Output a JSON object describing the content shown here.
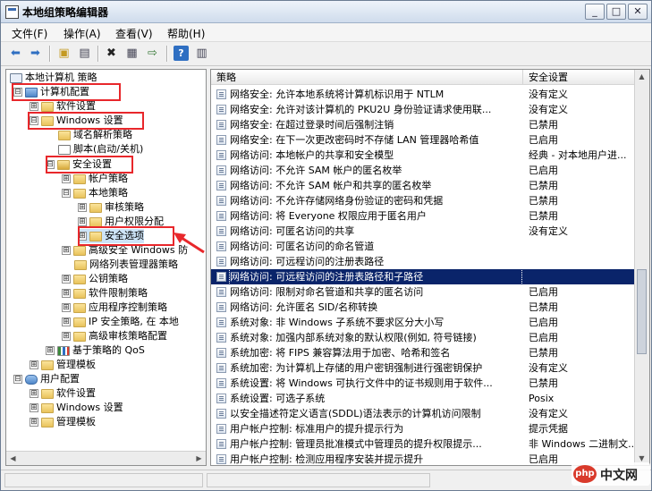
{
  "window": {
    "title": "本地组策略编辑器",
    "controls": [
      "_",
      "□",
      "✕"
    ]
  },
  "menu": [
    "文件(F)",
    "操作(A)",
    "查看(V)",
    "帮助(H)"
  ],
  "toolbar": {
    "icons": [
      "back-arrow-icon",
      "forward-arrow-icon",
      "up-folder-icon",
      "show-tree-icon",
      "delete-icon",
      "properties-icon",
      "export-icon",
      "help-icon",
      "view-icon"
    ]
  },
  "tree": {
    "items": [
      {
        "label": "本地计算机 策略",
        "expander": "",
        "icon": "policy"
      },
      {
        "label": "计算机配置",
        "expander": "⊟",
        "icon": "computer"
      },
      {
        "label": "软件设置",
        "expander": "⊞",
        "icon": "folder"
      },
      {
        "label": "Windows 设置",
        "expander": "⊟",
        "icon": "folder"
      },
      {
        "label": "域名解析策略",
        "expander": "",
        "icon": "folder"
      },
      {
        "label": "脚本(启动/关机)",
        "expander": "",
        "icon": "script"
      },
      {
        "label": "安全设置",
        "expander": "⊟",
        "icon": "security"
      },
      {
        "label": "帐户策略",
        "expander": "⊞",
        "icon": "folder"
      },
      {
        "label": "本地策略",
        "expander": "⊟",
        "icon": "folder"
      },
      {
        "label": "审核策略",
        "expander": "⊞",
        "icon": "folder"
      },
      {
        "label": "用户权限分配",
        "expander": "⊞",
        "icon": "folder"
      },
      {
        "label": "安全选项",
        "expander": "⊞",
        "icon": "folder"
      },
      {
        "label": "高级安全 Windows 防",
        "expander": "⊞",
        "icon": "folder"
      },
      {
        "label": "网络列表管理器策略",
        "expander": "",
        "icon": "folder"
      },
      {
        "label": "公钥策略",
        "expander": "⊞",
        "icon": "folder"
      },
      {
        "label": "软件限制策略",
        "expander": "⊞",
        "icon": "folder"
      },
      {
        "label": "应用程序控制策略",
        "expander": "⊞",
        "icon": "folder"
      },
      {
        "label": "IP 安全策略, 在 本地",
        "expander": "⊞",
        "icon": "folder"
      },
      {
        "label": "高级审核策略配置",
        "expander": "⊞",
        "icon": "folder"
      },
      {
        "label": "基于策略的 QoS",
        "expander": "⊞",
        "icon": "chart"
      },
      {
        "label": "管理模板",
        "expander": "⊞",
        "icon": "folder"
      },
      {
        "label": "用户配置",
        "expander": "⊟",
        "icon": "user"
      },
      {
        "label": "软件设置",
        "expander": "⊞",
        "icon": "folder"
      },
      {
        "label": "Windows 设置",
        "expander": "⊞",
        "icon": "folder"
      },
      {
        "label": "管理模板",
        "expander": "⊞",
        "icon": "folder"
      }
    ]
  },
  "list": {
    "columns": [
      "策略",
      "安全设置"
    ],
    "rows": [
      {
        "policy": "网络安全: 允许本地系统将计算机标识用于 NTLM",
        "setting": "没有定义"
      },
      {
        "policy": "网络安全: 允许对该计算机的 PKU2U 身份验证请求使用联...",
        "setting": "没有定义"
      },
      {
        "policy": "网络安全: 在超过登录时间后强制注销",
        "setting": "已禁用"
      },
      {
        "policy": "网络安全: 在下一次更改密码时不存储 LAN 管理器哈希值",
        "setting": "已启用"
      },
      {
        "policy": "网络访问: 本地帐户的共享和安全模型",
        "setting": "经典 - 对本地用户进..."
      },
      {
        "policy": "网络访问: 不允许 SAM 帐户的匿名枚举",
        "setting": "已启用"
      },
      {
        "policy": "网络访问: 不允许 SAM 帐户和共享的匿名枚举",
        "setting": "已禁用"
      },
      {
        "policy": "网络访问: 不允许存储网络身份验证的密码和凭据",
        "setting": "已禁用"
      },
      {
        "policy": "网络访问: 将 Everyone 权限应用于匿名用户",
        "setting": "已禁用"
      },
      {
        "policy": "网络访问: 可匿名访问的共享",
        "setting": "没有定义"
      },
      {
        "policy": "网络访问: 可匿名访问的命名管道",
        "setting": ""
      },
      {
        "policy": "网络访问: 可远程访问的注册表路径",
        "setting": ""
      },
      {
        "policy": "网络访问: 可远程访问的注册表路径和子路径",
        "setting": ""
      },
      {
        "policy": "网络访问: 限制对命名管道和共享的匿名访问",
        "setting": "已启用"
      },
      {
        "policy": "网络访问: 允许匿名 SID/名称转换",
        "setting": "已禁用"
      },
      {
        "policy": "系统对象: 非 Windows 子系统不要求区分大小写",
        "setting": "已启用"
      },
      {
        "policy": "系统对象: 加强内部系统对象的默认权限(例如, 符号链接)",
        "setting": "已启用"
      },
      {
        "policy": "系统加密: 将 FIPS 兼容算法用于加密、哈希和签名",
        "setting": "已禁用"
      },
      {
        "policy": "系统加密: 为计算机上存储的用户密钥强制进行强密钥保护",
        "setting": "没有定义"
      },
      {
        "policy": "系统设置: 将 Windows 可执行文件中的证书规则用于软件...",
        "setting": "已禁用"
      },
      {
        "policy": "系统设置: 可选子系统",
        "setting": "Posix"
      },
      {
        "policy": "以安全描述符定义语言(SDDL)语法表示的计算机访问限制",
        "setting": "没有定义"
      },
      {
        "policy": "用户帐户控制: 标准用户的提升提示行为",
        "setting": "提示凭据"
      },
      {
        "policy": "用户帐户控制: 管理员批准模式中管理员的提升权限提示...",
        "setting": "非 Windows 二进制文..."
      },
      {
        "policy": "用户帐户控制: 检测应用程序安装并提示提升",
        "setting": "已启用"
      }
    ]
  },
  "watermark": {
    "logo": "php",
    "text": "中文网"
  },
  "colors": {
    "highlight": "#e8272b",
    "selection": "#0a246a"
  }
}
